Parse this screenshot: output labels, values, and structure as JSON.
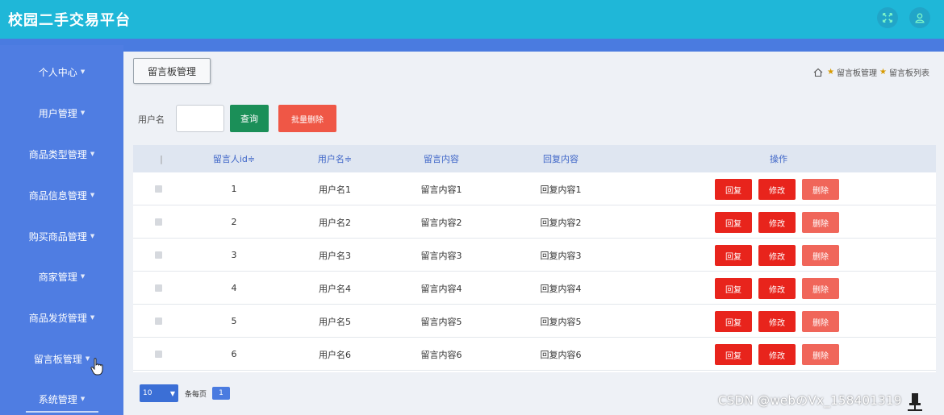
{
  "app": {
    "title": "校园二手交易平台",
    "icons": [
      "fullscreen-icon",
      "user-icon"
    ],
    "colors": {
      "header": "#1fb7d8",
      "sidebar": "#4f7de2",
      "query": "#1b8f58",
      "danger": "#e8241c"
    }
  },
  "sidebar": {
    "items": [
      {
        "label": "个人中心"
      },
      {
        "label": "用户管理"
      },
      {
        "label": "商品类型管理"
      },
      {
        "label": "商品信息管理"
      },
      {
        "label": "购买商品管理"
      },
      {
        "label": "商家管理"
      },
      {
        "label": "商品发货管理"
      },
      {
        "label": "留言板管理"
      },
      {
        "label": "系统管理"
      }
    ]
  },
  "main": {
    "tab_label": "留言板管理",
    "breadcrumb": [
      "留言板管理",
      "留言板列表"
    ]
  },
  "search": {
    "label": "用户名",
    "value": "",
    "query_button": "查询",
    "batch_delete_button": "批量删除"
  },
  "table": {
    "headers": {
      "select": "|",
      "id": "留言人id≑",
      "username": "用户名≑",
      "content": "留言内容",
      "reply": "回复内容",
      "actions": "操作"
    },
    "rows": [
      {
        "id": "1",
        "username": "用户名1",
        "content": "留言内容1",
        "reply": "回复内容1"
      },
      {
        "id": "2",
        "username": "用户名2",
        "content": "留言内容2",
        "reply": "回复内容2"
      },
      {
        "id": "3",
        "username": "用户名3",
        "content": "留言内容3",
        "reply": "回复内容3"
      },
      {
        "id": "4",
        "username": "用户名4",
        "content": "留言内容4",
        "reply": "回复内容4"
      },
      {
        "id": "5",
        "username": "用户名5",
        "content": "留言内容5",
        "reply": "回复内容5"
      },
      {
        "id": "6",
        "username": "用户名6",
        "content": "留言内容6",
        "reply": "回复内容6"
      }
    ],
    "action_labels": {
      "reply": "回复",
      "edit": "修改",
      "delete": "删除"
    }
  },
  "pagination": {
    "page_size": "10",
    "per_page_label": "条每页",
    "current_page": "1"
  },
  "watermark": "CSDN @webのVx_158401319"
}
